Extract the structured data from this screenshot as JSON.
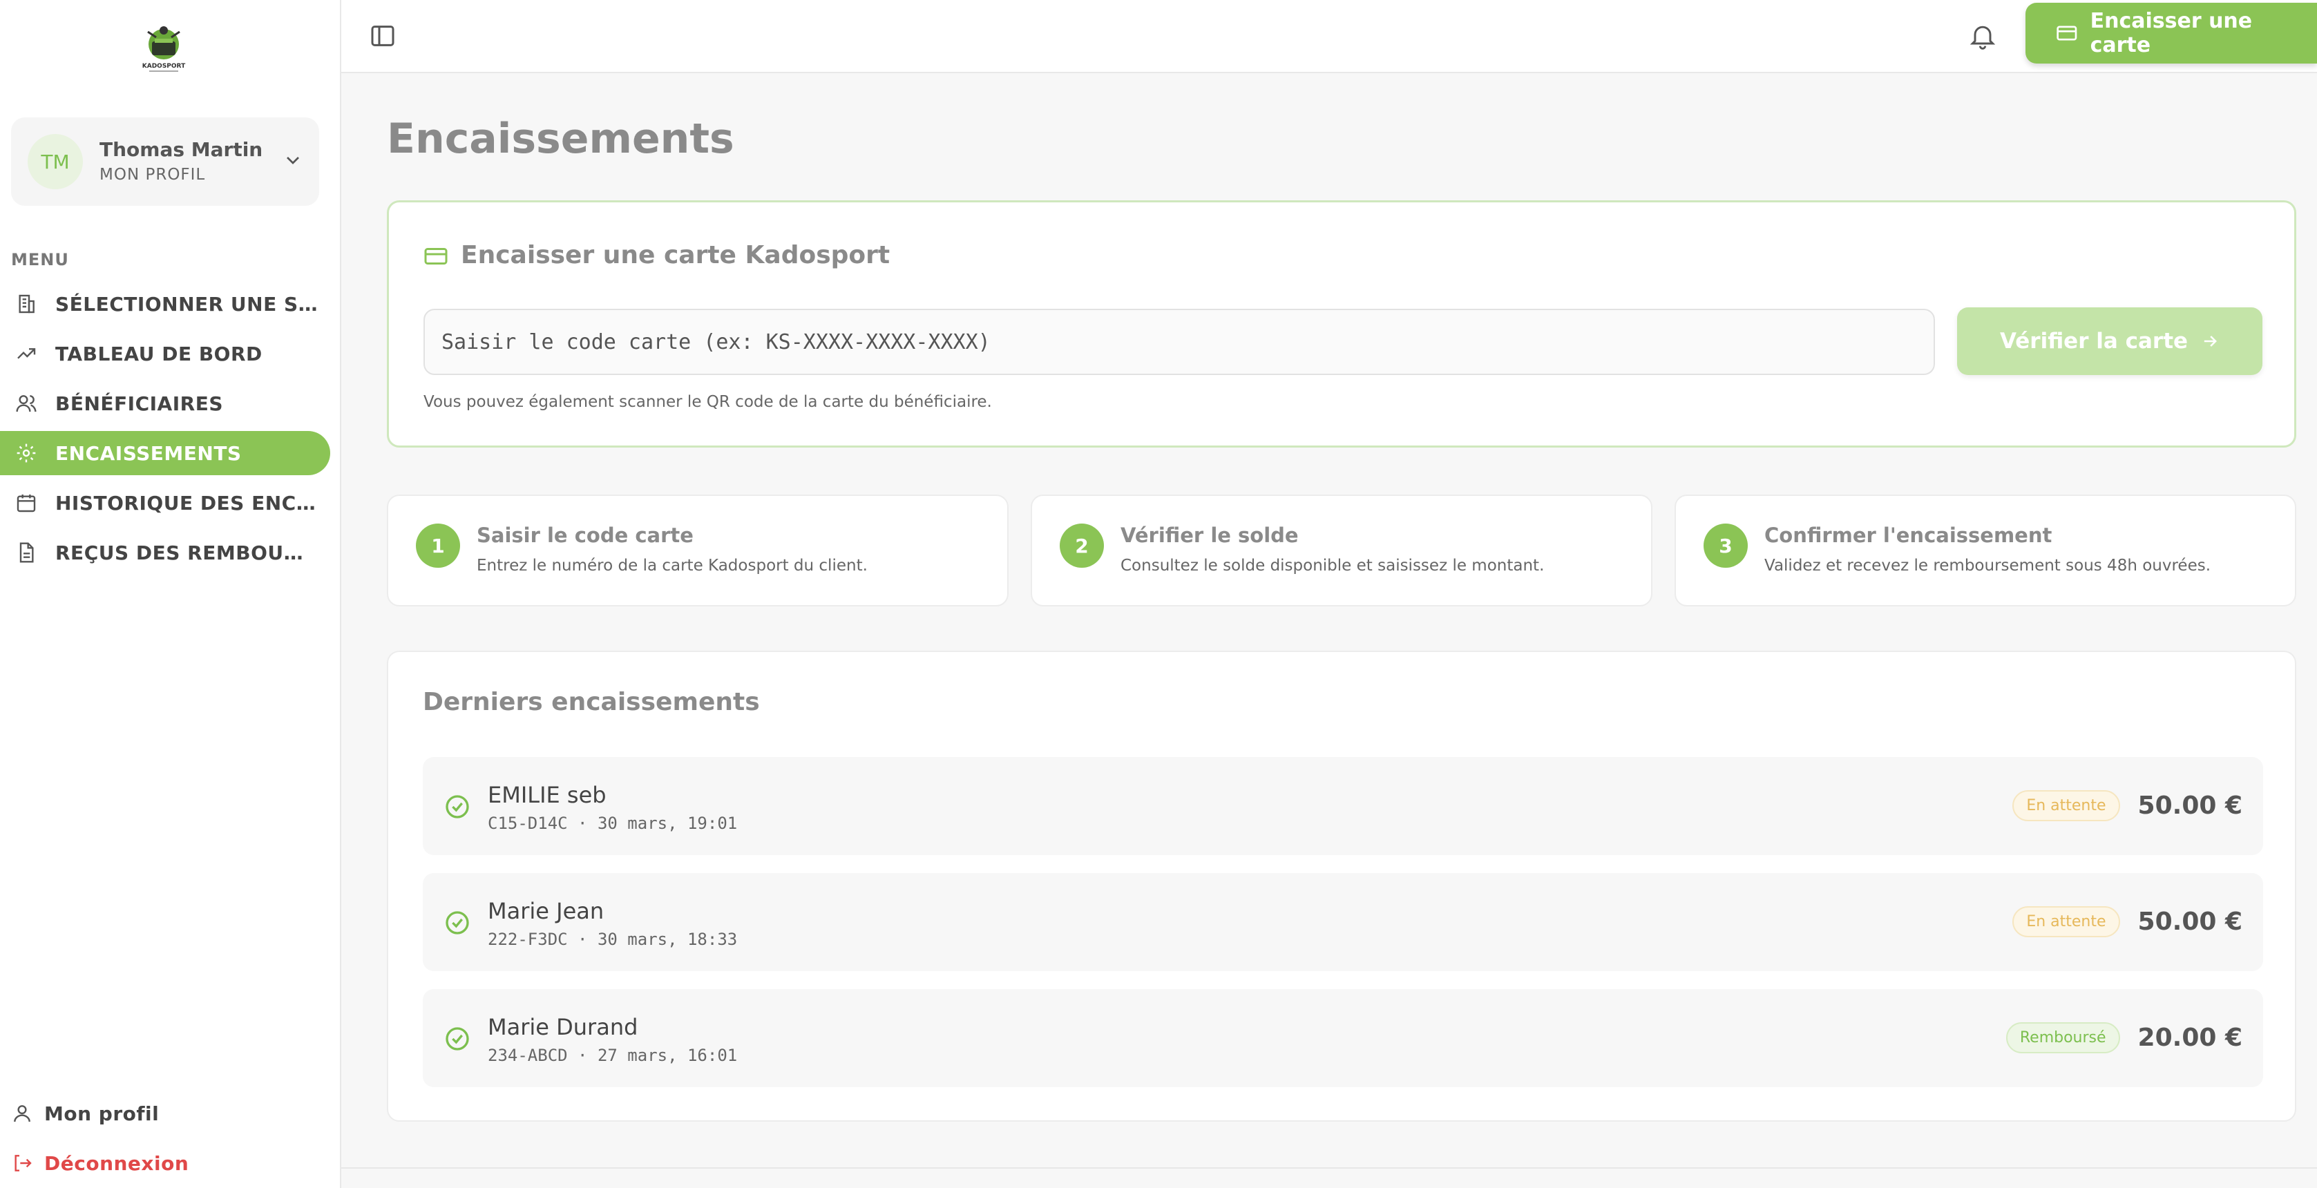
{
  "brand": {
    "logo_text": "KADOSPORT",
    "accent_color": "#8bc455"
  },
  "profile": {
    "initials": "TM",
    "name": "Thomas Martin",
    "subtitle": "MON PROFIL"
  },
  "sidebar": {
    "menu_label": "MENU",
    "items": [
      {
        "label": "SÉLECTIONNER UNE SALLE",
        "icon": "building-icon",
        "active": false
      },
      {
        "label": "TABLEAU DE BORD",
        "icon": "trending-up-icon",
        "active": false
      },
      {
        "label": "BÉNÉFICIAIRES",
        "icon": "users-icon",
        "active": false
      },
      {
        "label": "ENCAISSEMENTS",
        "icon": "gear-icon",
        "active": true
      },
      {
        "label": "HISTORIQUE DES ENCAISSEMENTS",
        "icon": "calendar-icon",
        "active": false
      },
      {
        "label": "REÇUS DES REMBOURSEMENTS",
        "icon": "document-icon",
        "active": false
      }
    ],
    "bottom": {
      "profile_label": "Mon profil",
      "logout_label": "Déconnexion"
    }
  },
  "topbar": {
    "cta_label": "Encaisser une carte"
  },
  "main": {
    "page_title": "Encaissements",
    "scan": {
      "title": "Encaisser une carte Kadosport",
      "input_placeholder": "Saisir le code carte (ex: KS-XXXX-XXXX-XXXX)",
      "input_value": "",
      "verify_label": "Vérifier la carte",
      "hint": "Vous pouvez également scanner le QR code de la carte du bénéficiaire."
    },
    "steps": [
      {
        "number": "1",
        "title": "Saisir le code carte",
        "desc": "Entrez le numéro de la carte Kadosport du client."
      },
      {
        "number": "2",
        "title": "Vérifier le solde",
        "desc": "Consultez le solde disponible et saisissez le montant."
      },
      {
        "number": "3",
        "title": "Confirmer l'encaissement",
        "desc": "Validez et recevez le remboursement sous 48h ouvrées."
      }
    ],
    "recent": {
      "title": "Derniers encaissements",
      "rows": [
        {
          "name": "EMILIE seb",
          "sub": "C15-D14C · 30 mars, 19:01",
          "status": "En attente",
          "amount": "50.00 €"
        },
        {
          "name": "Marie Jean",
          "sub": "222-F3DC · 30 mars, 18:33",
          "status": "En attente",
          "amount": "50.00 €"
        },
        {
          "name": "Marie Durand",
          "sub": "234-ABCD · 27 mars, 16:01",
          "status": "Remboursé",
          "amount": "20.00 €"
        }
      ]
    }
  }
}
